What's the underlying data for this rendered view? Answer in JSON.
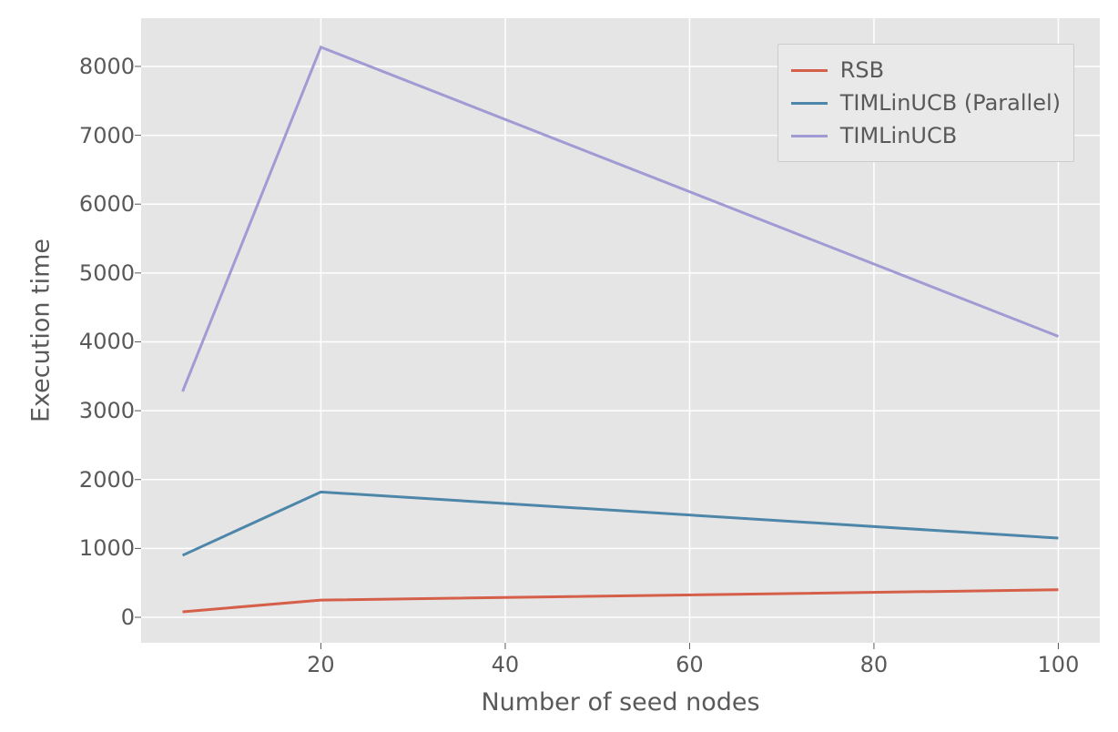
{
  "chart_data": {
    "type": "line",
    "xlabel": "Number of seed nodes",
    "ylabel": "Execution time",
    "title": "",
    "x_ticks": [
      20,
      40,
      60,
      80,
      100
    ],
    "y_ticks": [
      0,
      1000,
      2000,
      3000,
      4000,
      5000,
      6000,
      7000,
      8000
    ],
    "x_range": [
      0.5,
      104.5
    ],
    "y_range": [
      -370,
      8700
    ],
    "x": [
      5,
      20,
      100
    ],
    "series": [
      {
        "name": "RSB",
        "color": "#d65f4a",
        "values": [
          80,
          250,
          400
        ]
      },
      {
        "name": "TIMLinUCB (Parallel)",
        "color": "#4d86a9",
        "values": [
          900,
          1820,
          1150
        ]
      },
      {
        "name": "TIMLinUCB",
        "color": "#a19bd4",
        "values": [
          3280,
          8280,
          4080
        ]
      }
    ],
    "legend_position": "upper right",
    "grid": true
  }
}
